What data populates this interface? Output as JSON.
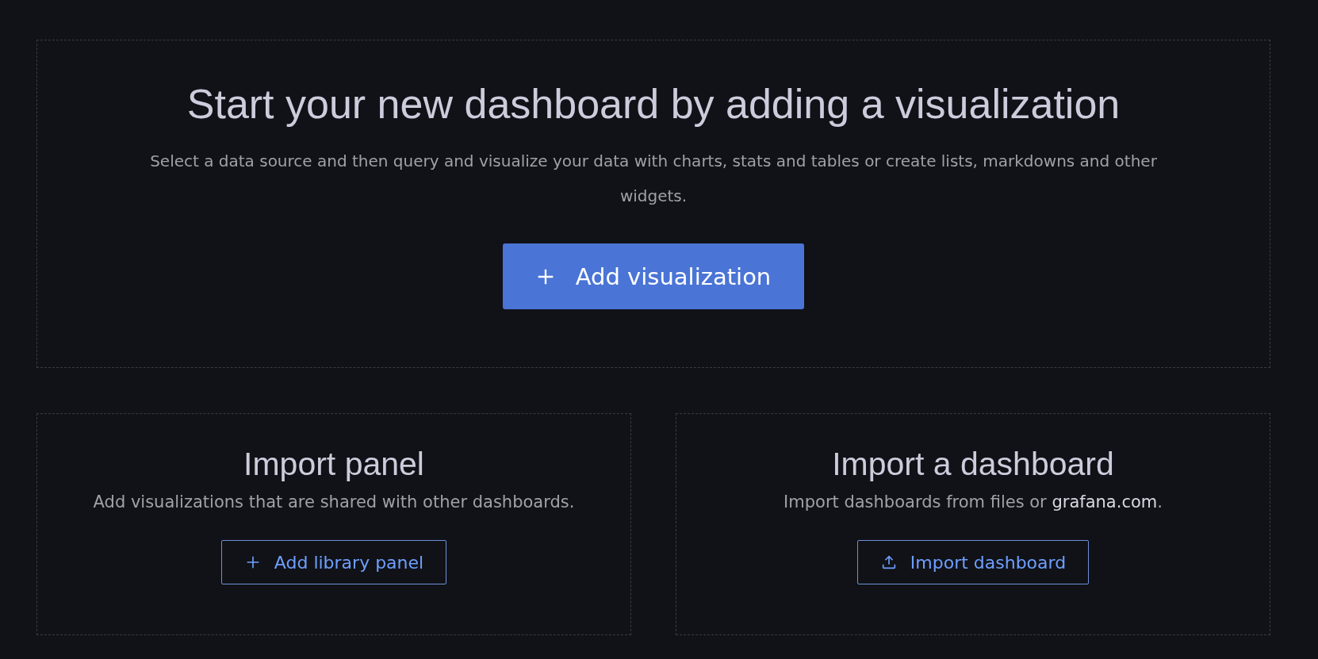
{
  "hero": {
    "title": "Start your new dashboard by adding a visualization",
    "description": "Select a data source and then query and visualize your data with charts, stats and tables or create lists, markdowns and other widgets.",
    "button": {
      "label": "Add visualization",
      "kind": "add"
    }
  },
  "cards": [
    {
      "title": "Import panel",
      "description": {
        "text": "Add visualizations that are shared with other dashboards."
      },
      "button": {
        "label": "Add library panel",
        "kind": "add"
      }
    },
    {
      "title": "Import a dashboard",
      "description": {
        "text": "Import dashboards from files or ",
        "link": "grafana.com",
        "suffix": "."
      },
      "button": {
        "label": "Import dashboard",
        "kind": "import"
      }
    }
  ]
}
